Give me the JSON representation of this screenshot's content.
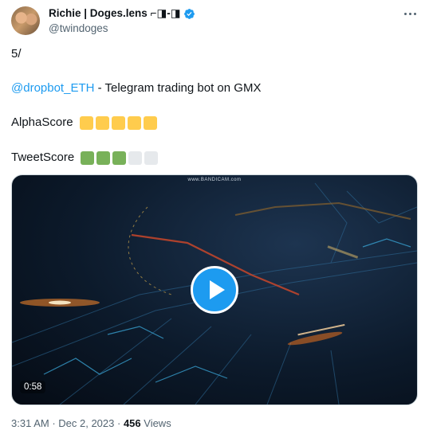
{
  "author": {
    "display_name": "Richie | Doges.lens ⌐◨-◨",
    "handle": "@twindoges"
  },
  "tweet": {
    "line1": "5/",
    "mention": "@dropbot_ETH",
    "line2_rest": " - Telegram trading bot on GMX",
    "alpha_label": "AlphaScore",
    "tweet_label": "TweetScore"
  },
  "alpha_score": {
    "filled": 5,
    "total": 5,
    "fill_color": "#ffcc4d",
    "empty_color": "#e6e9ec"
  },
  "tweet_score": {
    "filled": 3,
    "total": 5,
    "fill_color": "#78b159",
    "empty_color": "#e6e9ec"
  },
  "media": {
    "watermark": "www.BANDICAM.com",
    "duration": "0:58"
  },
  "meta": {
    "time": "3:31 AM",
    "separator": " · ",
    "date": "Dec 2, 2023",
    "views_count": "456",
    "views_label": " Views"
  },
  "colors": {
    "link": "#1d9bf0",
    "verified": "#1d9bf0",
    "secondary_text": "#536471"
  }
}
